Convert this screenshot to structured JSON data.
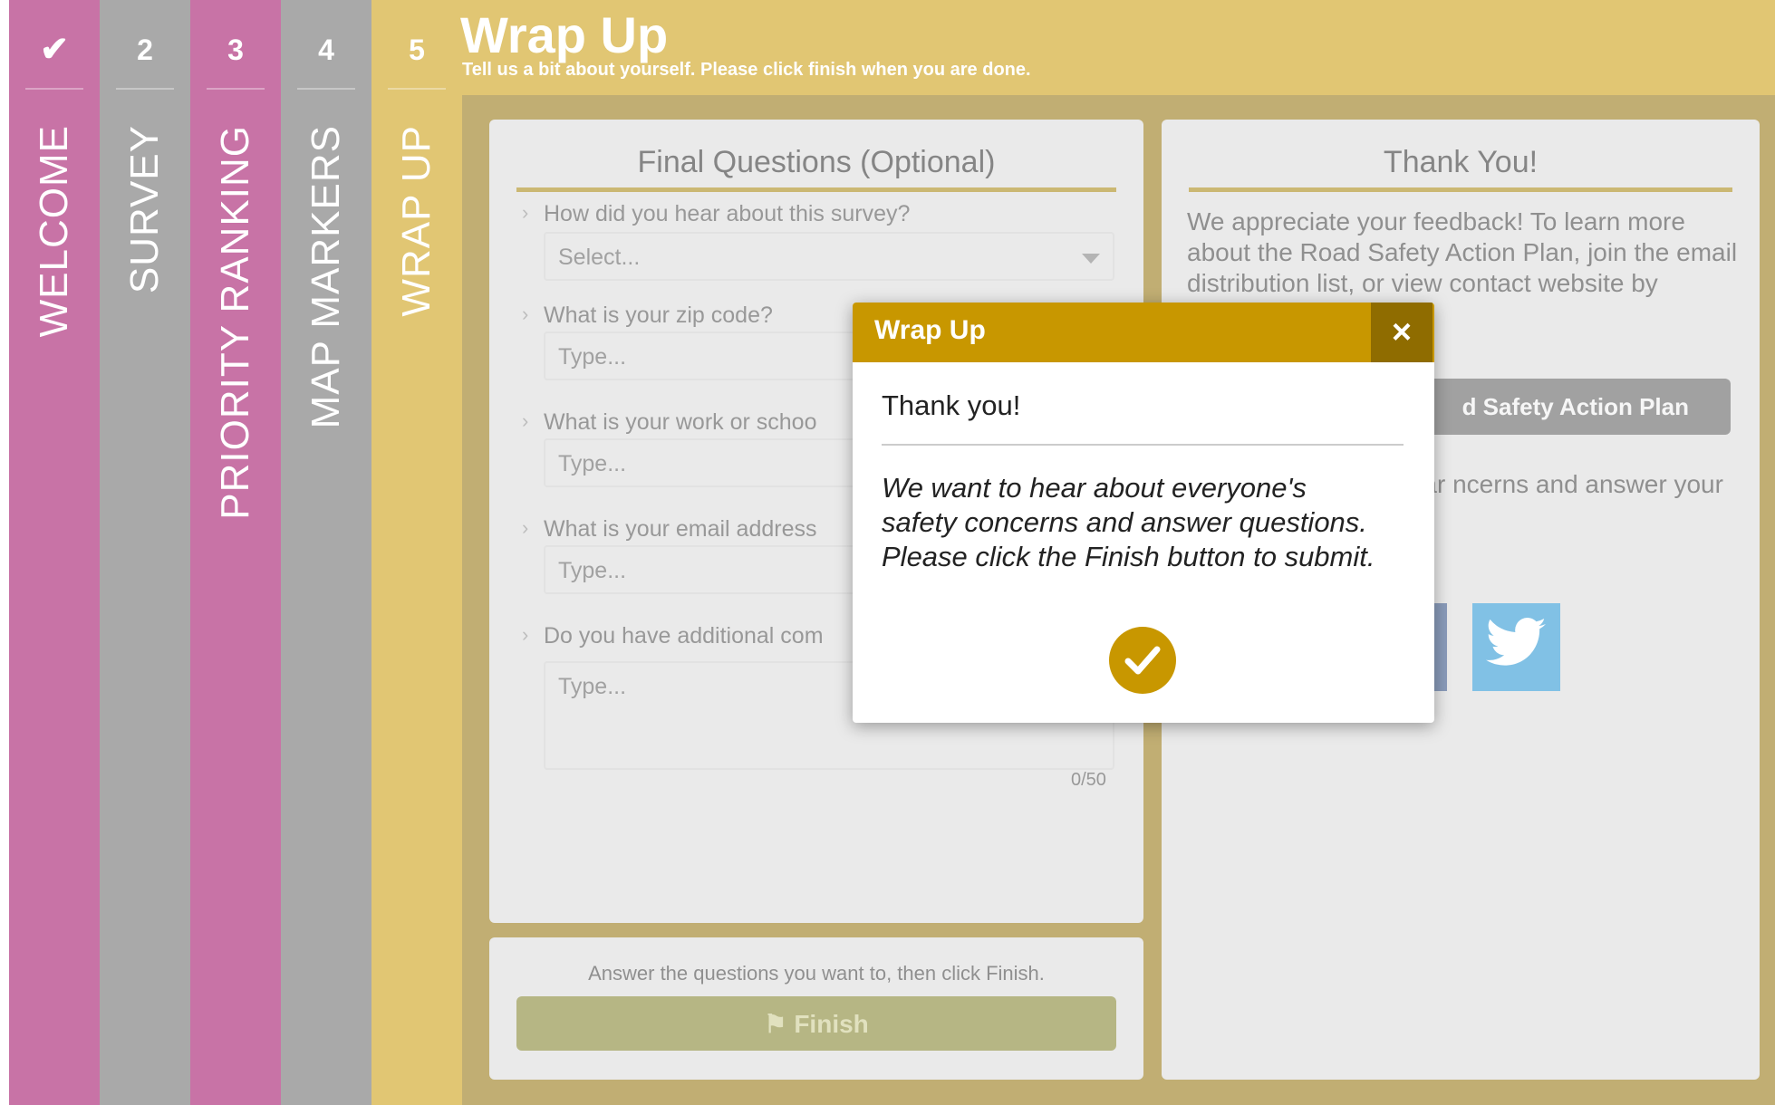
{
  "steps": [
    {
      "number": "✔",
      "label": "WELCOME"
    },
    {
      "number": "2",
      "label": "SURVEY"
    },
    {
      "number": "3",
      "label": "PRIORITY RANKING"
    },
    {
      "number": "4",
      "label": "MAP MARKERS"
    },
    {
      "number": "5",
      "label": "WRAP UP"
    }
  ],
  "header": {
    "title": "Wrap Up",
    "subtitle": "Tell us a bit about yourself. Please click finish when you are done."
  },
  "questions_panel": {
    "heading": "Final Questions (Optional)",
    "questions": [
      {
        "label": "How did you hear about this survey?",
        "placeholder": "Select...",
        "type": "select"
      },
      {
        "label": "What is your zip code?",
        "placeholder": "Type...",
        "type": "input"
      },
      {
        "label": "What is your work or schoo",
        "placeholder": "Type...",
        "type": "input"
      },
      {
        "label": "What is your email address",
        "placeholder": "Type...",
        "type": "input"
      },
      {
        "label": "Do you have additional com",
        "placeholder": "Type...",
        "type": "textarea"
      }
    ],
    "char_count": "0/50"
  },
  "thanks_panel": {
    "heading": "Thank You!",
    "text": "We appreciate your feedback! To learn more about the Road Safety Action Plan, join the email distribution list, or view contact",
    "text_tail": "website by clicking",
    "button_label": "d Safety Action Plan",
    "text2": "urvey. We want to hear ncerns and answer your estions."
  },
  "finish_panel": {
    "hint": "Answer the questions you want to, then click Finish.",
    "button_label": "Finish"
  },
  "modal": {
    "title": "Wrap Up",
    "close_label": "×",
    "heading": "Thank you!",
    "message": "We want to hear about everyone's safety concerns and answer questions. Please click the Finish button to submit."
  },
  "colors": {
    "magenta": "#9b005e",
    "gray": "#636363",
    "gold": "#c89700",
    "dark_gold": "#8f6c00",
    "olive_button": "#7a7a20"
  },
  "icons": {
    "step1": "check-icon",
    "close": "close-icon",
    "confirm": "check-circle-icon",
    "finish": "flag-icon",
    "social": [
      "facebook-icon",
      "twitter-icon"
    ]
  }
}
